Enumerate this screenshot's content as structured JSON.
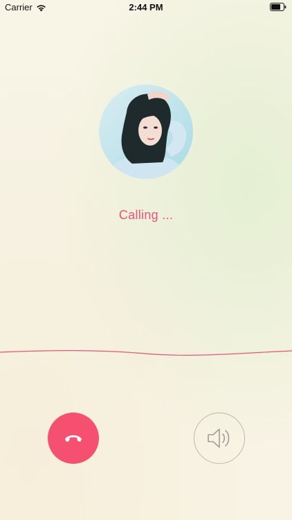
{
  "status_bar": {
    "carrier": "Carrier",
    "time": "2:44 PM",
    "wifi_icon": "wifi-icon",
    "battery_icon": "battery-icon"
  },
  "call": {
    "status_text": "Calling ...",
    "accent_color": "#e8547a"
  },
  "controls": {
    "hangup_icon": "phone-hangup-icon",
    "hangup_color": "#f5506f",
    "speaker_icon": "speaker-icon"
  }
}
